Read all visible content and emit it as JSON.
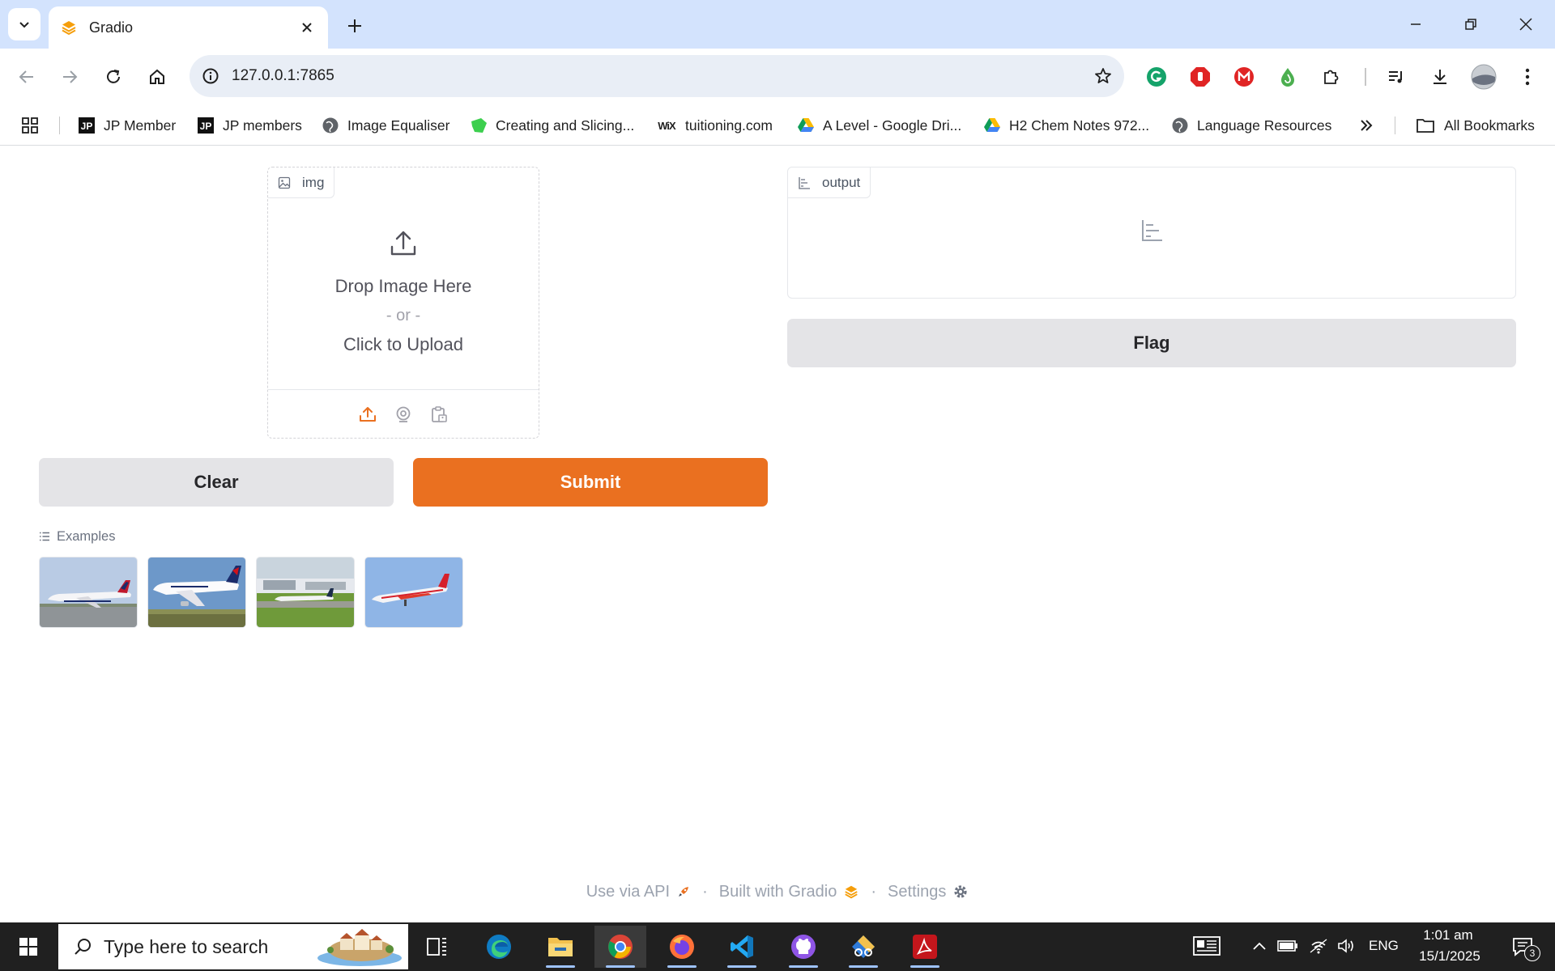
{
  "browser": {
    "tab_title": "Gradio",
    "url": "127.0.0.1:7865",
    "bookmarks": [
      {
        "label": "JP Member",
        "icon": "jp-icon"
      },
      {
        "label": "JP members",
        "icon": "jp-icon"
      },
      {
        "label": "Image Equaliser",
        "icon": "globe-icon"
      },
      {
        "label": "Creating and Slicing...",
        "icon": "green-leaf-icon"
      },
      {
        "label": "tuitioning.com",
        "icon": "wix-icon"
      },
      {
        "label": "A Level - Google Dri...",
        "icon": "google-drive-icon"
      },
      {
        "label": "H2 Chem Notes 972...",
        "icon": "google-drive-icon"
      },
      {
        "label": "Language Resources",
        "icon": "globe-icon"
      }
    ],
    "all_bookmarks_label": "All Bookmarks",
    "wix_text": "WiX"
  },
  "gradio": {
    "input_label": "img",
    "drop_text": "Drop Image Here",
    "or_text": "- or -",
    "click_text": "Click to Upload",
    "output_label": "output",
    "flag_label": "Flag",
    "clear_label": "Clear",
    "submit_label": "Submit",
    "examples_label": "Examples",
    "examples": [
      {
        "icon": "airplane-thumbnail-delta"
      },
      {
        "icon": "airplane-thumbnail-airfrance"
      },
      {
        "icon": "airplane-thumbnail-lufthansa"
      },
      {
        "icon": "airplane-thumbnail-atr"
      }
    ],
    "footer": {
      "api": "Use via API",
      "built": "Built with Gradio",
      "settings": "Settings",
      "dot": "·"
    },
    "colors": {
      "accent": "#ea7020",
      "secondary": "#e4e4e7"
    }
  },
  "taskbar": {
    "search_placeholder": "Type here to search",
    "language": "ENG",
    "time": "1:01 am",
    "date": "15/1/2025",
    "notifications": "3"
  }
}
